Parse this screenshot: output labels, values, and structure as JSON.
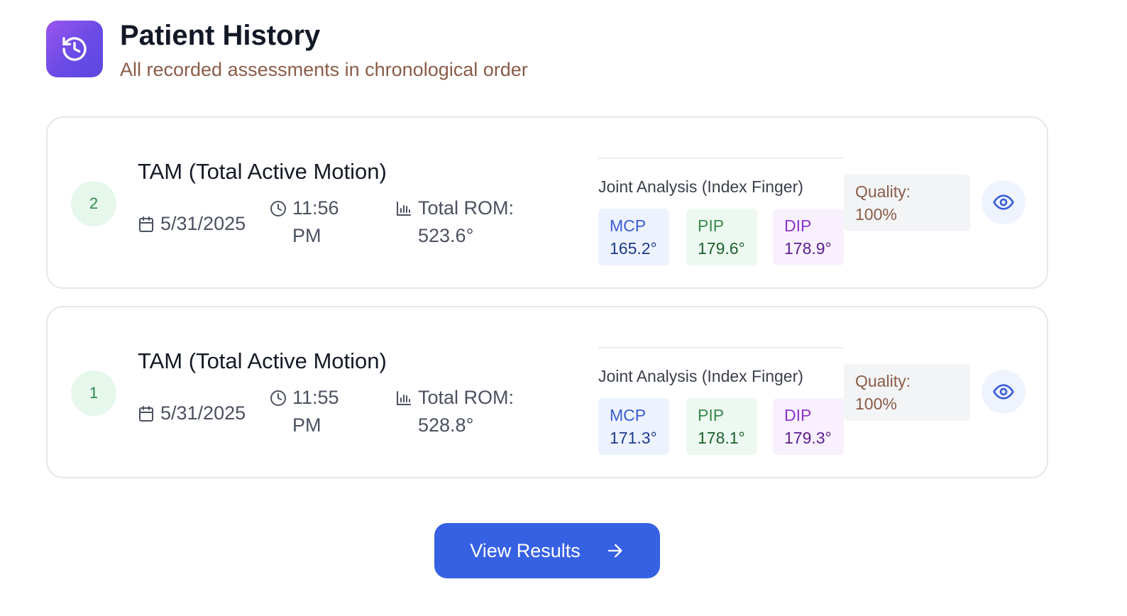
{
  "header": {
    "title": "Patient History",
    "subtitle": "All recorded assessments in chronological order",
    "icon": "history-icon"
  },
  "assessments": [
    {
      "number": "2",
      "title": "TAM (Total Active Motion)",
      "date": "5/31/2025",
      "time": "11:56 PM",
      "total_rom": "Total ROM: 523.6°",
      "joint_title": "Joint Analysis (Index Finger)",
      "joints": [
        {
          "label": "MCP",
          "value": "165.2°"
        },
        {
          "label": "PIP",
          "value": "179.6°"
        },
        {
          "label": "DIP",
          "value": "178.9°"
        }
      ],
      "quality_label": "Quality:",
      "quality_value": "100%"
    },
    {
      "number": "1",
      "title": "TAM (Total Active Motion)",
      "date": "5/31/2025",
      "time": "11:55 PM",
      "total_rom": "Total ROM: 528.8°",
      "joint_title": "Joint Analysis (Index Finger)",
      "joints": [
        {
          "label": "MCP",
          "value": "171.3°"
        },
        {
          "label": "PIP",
          "value": "178.1°"
        },
        {
          "label": "DIP",
          "value": "179.3°"
        }
      ],
      "quality_label": "Quality:",
      "quality_value": "100%"
    }
  ],
  "actions": {
    "view_results_label": "View Results"
  },
  "colors": {
    "primary": "#3661e3",
    "accent_gradient_start": "#9b55ee",
    "accent_gradient_end": "#5b48e0",
    "badge_bg": "#e6f7ec",
    "badge_text": "#2d8a4e"
  }
}
